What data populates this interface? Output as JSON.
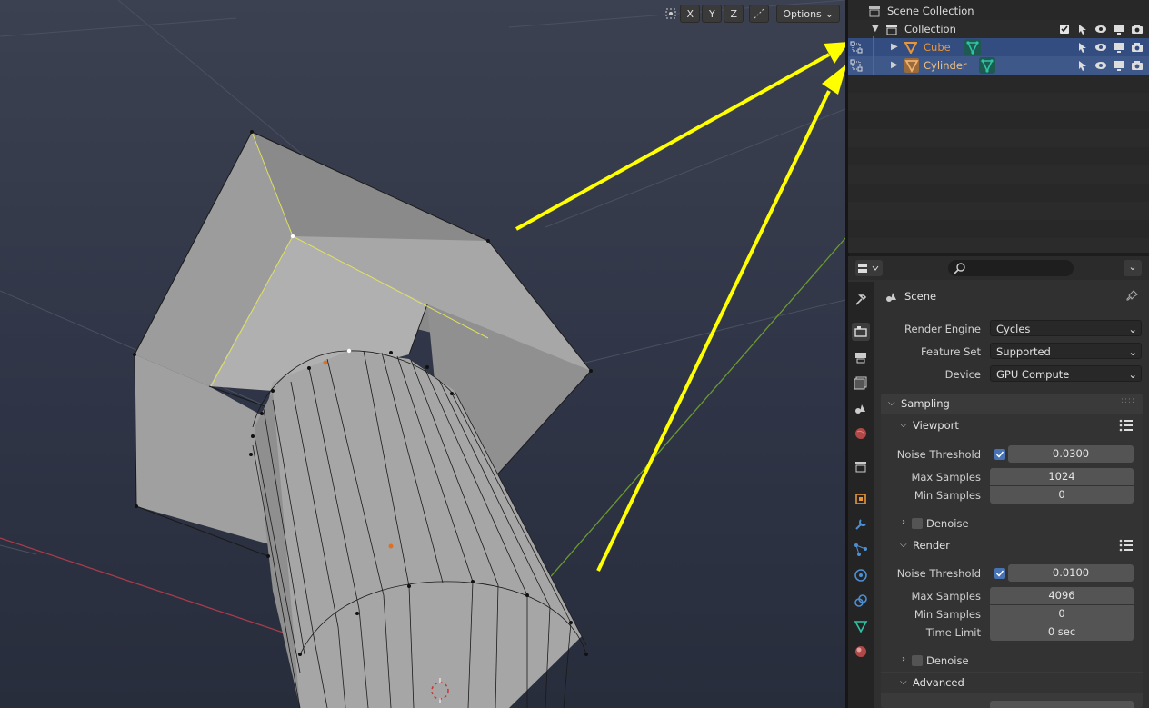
{
  "viewport": {
    "axis_x": "X",
    "axis_y": "Y",
    "axis_z": "Z",
    "options_label": "Options"
  },
  "outliner": {
    "scene_collection": "Scene Collection",
    "collection": "Collection",
    "items": [
      {
        "name": "Cube"
      },
      {
        "name": "Cylinder"
      }
    ]
  },
  "properties": {
    "search_placeholder": "",
    "scene_title": "Scene",
    "render_engine_label": "Render Engine",
    "render_engine_value": "Cycles",
    "feature_set_label": "Feature Set",
    "feature_set_value": "Supported",
    "device_label": "Device",
    "device_value": "GPU Compute",
    "sampling": {
      "title": "Sampling",
      "viewport": {
        "title": "Viewport",
        "noise_threshold_label": "Noise Threshold",
        "noise_threshold_value": "0.0300",
        "max_samples_label": "Max Samples",
        "max_samples_value": "1024",
        "min_samples_label": "Min Samples",
        "min_samples_value": "0",
        "denoise_label": "Denoise"
      },
      "render": {
        "title": "Render",
        "noise_threshold_label": "Noise Threshold",
        "noise_threshold_value": "0.0100",
        "max_samples_label": "Max Samples",
        "max_samples_value": "4096",
        "min_samples_label": "Min Samples",
        "min_samples_value": "0",
        "time_limit_label": "Time Limit",
        "time_limit_value": "0 sec",
        "denoise_label": "Denoise"
      },
      "advanced_title": "Advanced"
    }
  },
  "colors": {
    "accent_blue": "#4772b3",
    "selection": "#334d80",
    "object_orange": "#e8943a",
    "mesh_green": "#2ec4a6",
    "annotation_yellow": "#ffff00"
  }
}
